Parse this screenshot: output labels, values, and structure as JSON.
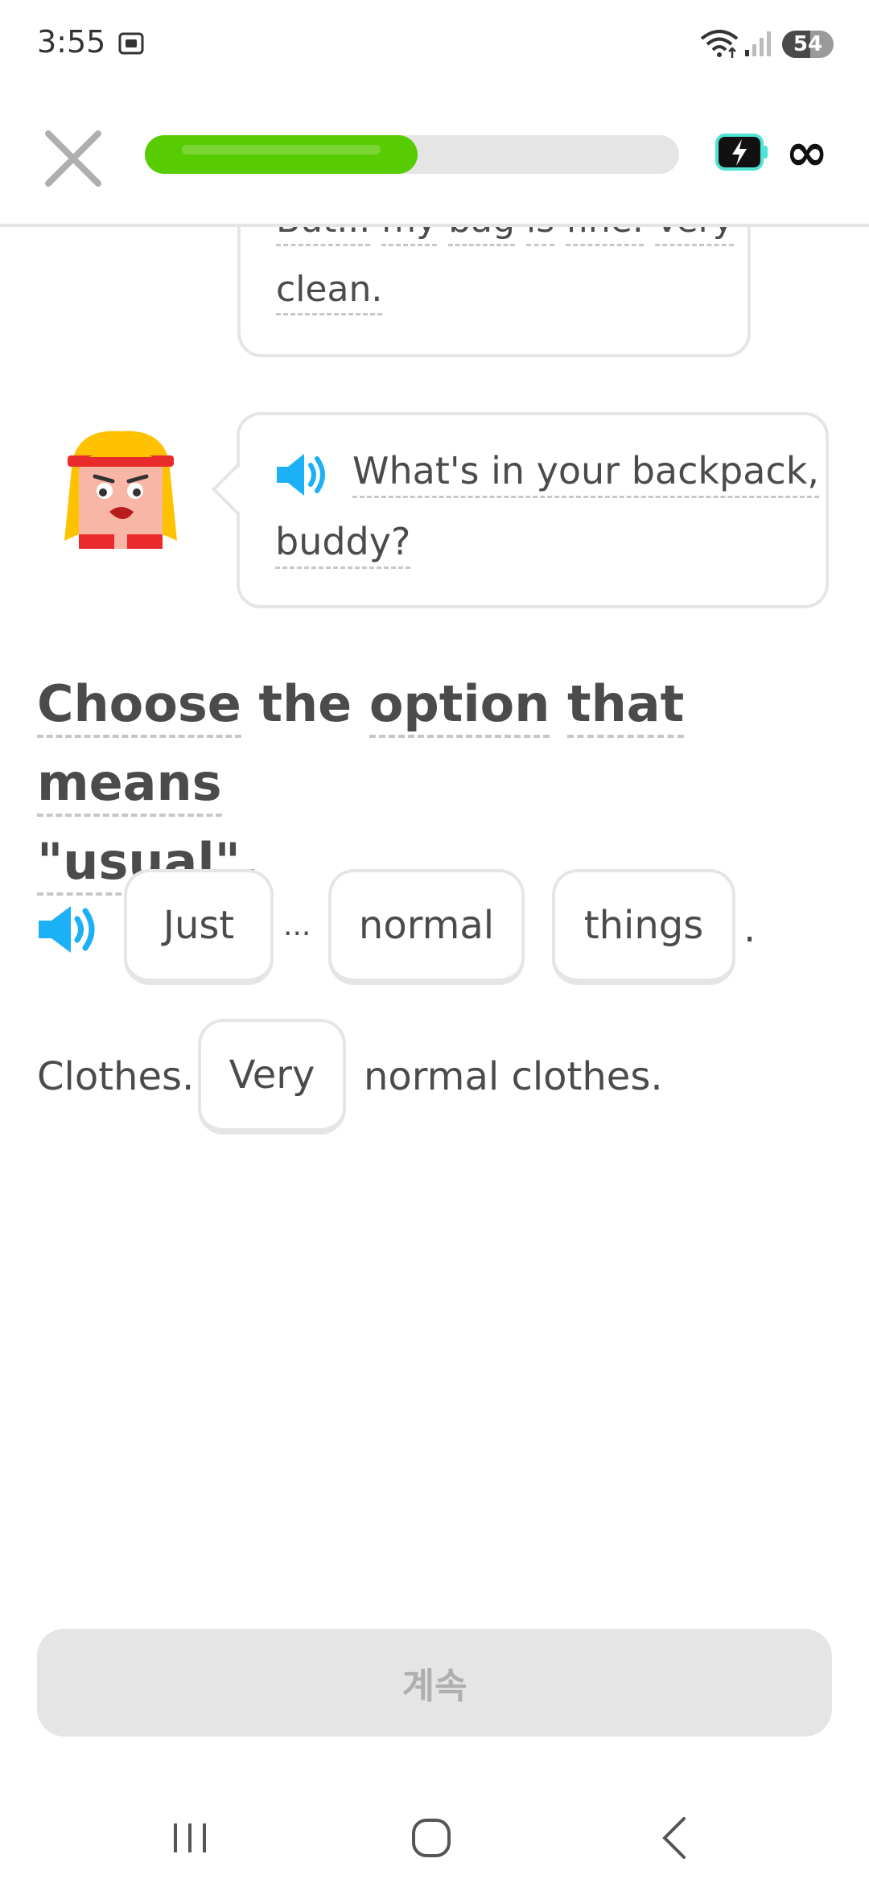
{
  "status_bar": {
    "time": "3:55",
    "battery_level": "54",
    "battery_fill_fraction": 0.54,
    "icons": [
      "screenshot-icon",
      "wifi-icon",
      "signal-icon"
    ]
  },
  "header": {
    "progress_fraction": 0.51,
    "energy_icon": "lightning-battery-icon",
    "energy_label": "∞",
    "accent_color": "#58cc02"
  },
  "previous_bubble": {
    "line1_words": [
      "But...",
      "my",
      "bag",
      "is",
      "fine.",
      "Very"
    ],
    "line2": "clean."
  },
  "speech_bubble": {
    "text_line1": "What's in your backpack,",
    "text_line2": "buddy?"
  },
  "prompt": {
    "words": [
      "Choose",
      "the",
      "option",
      "that",
      "means"
    ],
    "line2": "\"usual\"."
  },
  "sentence": {
    "options_row1": [
      "Just",
      "normal",
      "things"
    ],
    "ellipsis": "...",
    "period": ".",
    "row2_prefix": "Clothes.",
    "option_row2": "Very",
    "row2_suffix": "normal clothes."
  },
  "continue_button": {
    "label": "계속"
  },
  "colors": {
    "speaker_blue": "#1cb0f6",
    "border_gray": "#e5e5e5"
  }
}
